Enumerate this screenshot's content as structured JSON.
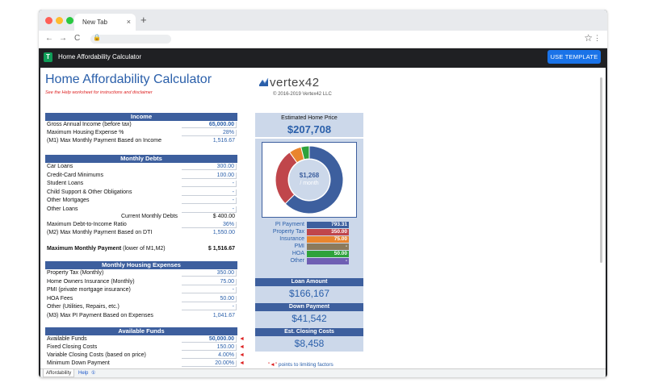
{
  "browser": {
    "tab_title": "New Tab",
    "tab_close": "×",
    "new_tab": "+",
    "back": "←",
    "forward": "→",
    "reload": "C",
    "lock": "🔒",
    "bookmark": "☆",
    "menu": "⋮"
  },
  "app": {
    "title": "Home Affordability Calculator",
    "use_template": "USE TEMPLATE",
    "icon_letter": "T"
  },
  "sheet": {
    "title": "Home Affordability Calculator",
    "subtitle": "See the Help worksheet for instructions and disclaimer",
    "logo_text": "vertex42",
    "copyright": "© 2016-2019 Vertex42 LLC"
  },
  "income": {
    "header": "Income",
    "rows": [
      {
        "label": "Gross Annual Income (before tax)",
        "value": "65,000.00"
      },
      {
        "label": "Maximum Housing Expense %",
        "value": "28%"
      },
      {
        "label": "(M1) Max Monthly Payment Based on Income",
        "value": "1,516.67"
      }
    ]
  },
  "debts": {
    "header": "Monthly Debts",
    "rows": [
      {
        "label": "Car Loans",
        "value": "300.00"
      },
      {
        "label": "Credit-Card Minimums",
        "value": "100.00"
      },
      {
        "label": "Student Loans",
        "value": "-"
      },
      {
        "label": "Child Support & Other Obligations",
        "value": "-"
      },
      {
        "label": "Other Mortgages",
        "value": "-"
      },
      {
        "label": "Other Loans",
        "value": "-"
      }
    ],
    "current_label": "Current Monthly Debts",
    "current_value": "$ 400.00",
    "ratio_label": "Maximum Debt-to-Income Ratio",
    "ratio_value": "36%",
    "m2_label": "(M2) Max Monthly Payment Based on DTI",
    "m2_value": "1,550.00",
    "max_label": "Maximum Monthly Payment",
    "max_label_suffix": " (lower of M1,M2)",
    "max_value": "$ 1,516.67"
  },
  "housing": {
    "header": "Monthly Housing Expenses",
    "rows": [
      {
        "label": "Property Tax (Monthly)",
        "value": "350.00"
      },
      {
        "label": "Home Owners Insurance (Monthly)",
        "value": "75.00"
      },
      {
        "label": "PMI (private mortgage insurance)",
        "value": "-"
      },
      {
        "label": "HOA Fees",
        "value": "50.00"
      },
      {
        "label": "Other (Utilities, Repairs, etc.)",
        "value": "-"
      },
      {
        "label": "(M3) Max PI Payment Based on Expenses",
        "value": "1,041.67"
      }
    ]
  },
  "funds": {
    "header": "Available Funds",
    "rows": [
      {
        "label": "Available Funds",
        "value": "50,000.00"
      },
      {
        "label": "Fixed Closing Costs",
        "value": "150.00"
      },
      {
        "label": "Variable Closing Costs (based on price)",
        "value": "4.00%"
      },
      {
        "label": "Minimum Down Payment",
        "value": "20.00%"
      }
    ],
    "marker": "◄"
  },
  "summary": {
    "price_label": "Estimated Home Price",
    "price_value": "$207,708",
    "donut_center_value": "$1,268",
    "donut_center_unit": "/ month",
    "legend": [
      {
        "label": "PI Payment",
        "value": "793.31",
        "color": "#3d5f9e",
        "amount": 793.31
      },
      {
        "label": "Property Tax",
        "value": "350.00",
        "color": "#c0464b",
        "amount": 350.0
      },
      {
        "label": "Insurance",
        "value": "75.00",
        "color": "#e9852e",
        "amount": 75.0
      },
      {
        "label": "PMI",
        "value": "-",
        "color": "#8b7a5c",
        "amount": 0
      },
      {
        "label": "HOA",
        "value": "50.00",
        "color": "#2ea23c",
        "amount": 50.0
      },
      {
        "label": "Other",
        "value": "-",
        "color": "#6f5fb3",
        "amount": 0
      }
    ],
    "loan_label": "Loan Amount",
    "loan_value": "$166,167",
    "down_label": "Down Payment",
    "down_value": "$41,542",
    "closing_label": "Est. Closing Costs",
    "closing_value": "$8,458"
  },
  "footer_note_mark": "\"◄\"",
  "footer_note_text": " points to limiting factors",
  "tabs": [
    "Affordability",
    "Help",
    "①"
  ]
}
